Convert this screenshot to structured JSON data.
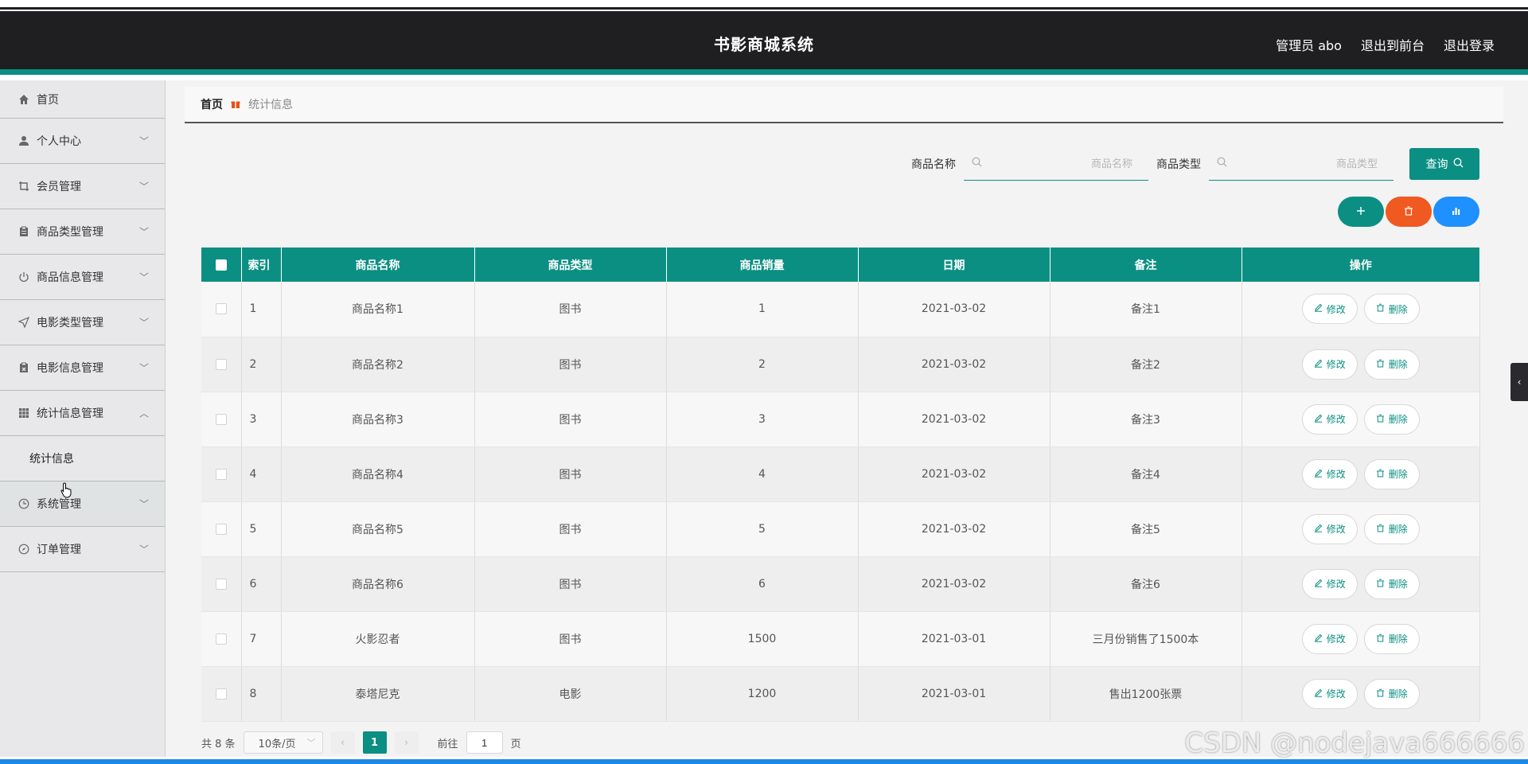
{
  "app": {
    "title": "书影商城系统",
    "user": "管理员 abo",
    "to_front": "退出到前台",
    "logout": "退出登录"
  },
  "sidebar": {
    "items": [
      {
        "label": "首页",
        "icon": "home-icon"
      },
      {
        "label": "个人中心",
        "icon": "user-icon"
      },
      {
        "label": "会员管理",
        "icon": "crop-icon"
      },
      {
        "label": "商品类型管理",
        "icon": "clipboard-icon"
      },
      {
        "label": "商品信息管理",
        "icon": "power-icon"
      },
      {
        "label": "电影类型管理",
        "icon": "send-icon"
      },
      {
        "label": "电影信息管理",
        "icon": "clipboard-x-icon"
      },
      {
        "label": "统计信息管理",
        "icon": "grid-icon"
      },
      {
        "label": "统计信息",
        "icon": ""
      },
      {
        "label": "系统管理",
        "icon": "clock-icon"
      },
      {
        "label": "订单管理",
        "icon": "compass-icon"
      }
    ]
  },
  "breadcrumb": {
    "home": "首页",
    "current": "统计信息"
  },
  "search": {
    "name_label": "商品名称",
    "name_placeholder": "商品名称",
    "type_label": "商品类型",
    "type_placeholder": "商品类型",
    "query_label": "查询"
  },
  "table": {
    "headers": [
      "索引",
      "商品名称",
      "商品类型",
      "商品销量",
      "日期",
      "备注",
      "操作"
    ],
    "edit_label": "修改",
    "delete_label": "删除",
    "rows": [
      {
        "idx": "1",
        "name": "商品名称1",
        "type": "图书",
        "sales": "1",
        "date": "2021-03-02",
        "note": "备注1"
      },
      {
        "idx": "2",
        "name": "商品名称2",
        "type": "图书",
        "sales": "2",
        "date": "2021-03-02",
        "note": "备注2"
      },
      {
        "idx": "3",
        "name": "商品名称3",
        "type": "图书",
        "sales": "3",
        "date": "2021-03-02",
        "note": "备注3"
      },
      {
        "idx": "4",
        "name": "商品名称4",
        "type": "图书",
        "sales": "4",
        "date": "2021-03-02",
        "note": "备注4"
      },
      {
        "idx": "5",
        "name": "商品名称5",
        "type": "图书",
        "sales": "5",
        "date": "2021-03-02",
        "note": "备注5"
      },
      {
        "idx": "6",
        "name": "商品名称6",
        "type": "图书",
        "sales": "6",
        "date": "2021-03-02",
        "note": "备注6"
      },
      {
        "idx": "7",
        "name": "火影忍者",
        "type": "图书",
        "sales": "1500",
        "date": "2021-03-01",
        "note": "三月份销售了1500本"
      },
      {
        "idx": "8",
        "name": "泰塔尼克",
        "type": "电影",
        "sales": "1200",
        "date": "2021-03-01",
        "note": "售出1200张票"
      }
    ]
  },
  "pager": {
    "total": "共 8 条",
    "page_size": "10条/页",
    "current_page": "1",
    "goto_label": "前往",
    "goto_value": "1",
    "page_unit": "页"
  },
  "watermark": "CSDN @nodejava666666",
  "colors": {
    "primary": "#0b8f82",
    "danger": "#f0591f",
    "info": "#1e90ff",
    "header_bg": "#1f1f22"
  }
}
